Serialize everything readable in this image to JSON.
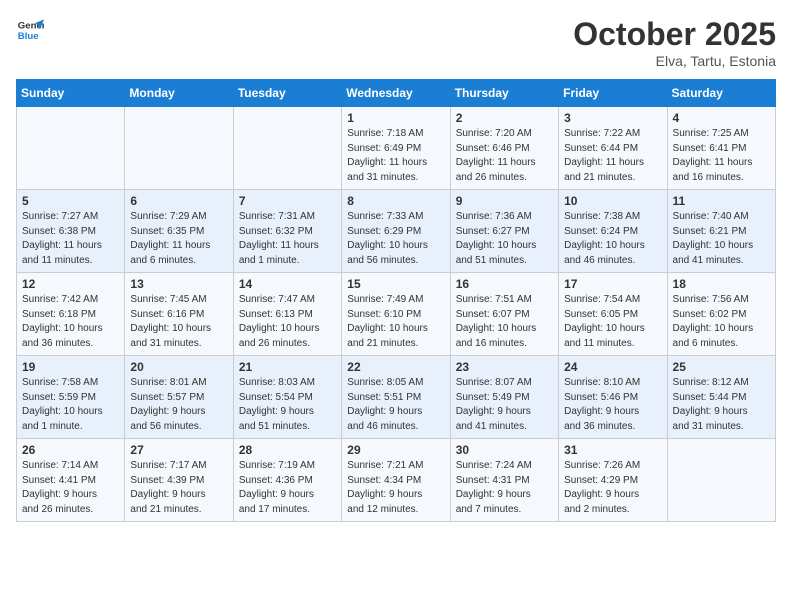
{
  "header": {
    "logo_line1": "General",
    "logo_line2": "Blue",
    "month": "October 2025",
    "location": "Elva, Tartu, Estonia"
  },
  "weekdays": [
    "Sunday",
    "Monday",
    "Tuesday",
    "Wednesday",
    "Thursday",
    "Friday",
    "Saturday"
  ],
  "weeks": [
    [
      {
        "day": "",
        "info": ""
      },
      {
        "day": "",
        "info": ""
      },
      {
        "day": "",
        "info": ""
      },
      {
        "day": "1",
        "info": "Sunrise: 7:18 AM\nSunset: 6:49 PM\nDaylight: 11 hours\nand 31 minutes."
      },
      {
        "day": "2",
        "info": "Sunrise: 7:20 AM\nSunset: 6:46 PM\nDaylight: 11 hours\nand 26 minutes."
      },
      {
        "day": "3",
        "info": "Sunrise: 7:22 AM\nSunset: 6:44 PM\nDaylight: 11 hours\nand 21 minutes."
      },
      {
        "day": "4",
        "info": "Sunrise: 7:25 AM\nSunset: 6:41 PM\nDaylight: 11 hours\nand 16 minutes."
      }
    ],
    [
      {
        "day": "5",
        "info": "Sunrise: 7:27 AM\nSunset: 6:38 PM\nDaylight: 11 hours\nand 11 minutes."
      },
      {
        "day": "6",
        "info": "Sunrise: 7:29 AM\nSunset: 6:35 PM\nDaylight: 11 hours\nand 6 minutes."
      },
      {
        "day": "7",
        "info": "Sunrise: 7:31 AM\nSunset: 6:32 PM\nDaylight: 11 hours\nand 1 minute."
      },
      {
        "day": "8",
        "info": "Sunrise: 7:33 AM\nSunset: 6:29 PM\nDaylight: 10 hours\nand 56 minutes."
      },
      {
        "day": "9",
        "info": "Sunrise: 7:36 AM\nSunset: 6:27 PM\nDaylight: 10 hours\nand 51 minutes."
      },
      {
        "day": "10",
        "info": "Sunrise: 7:38 AM\nSunset: 6:24 PM\nDaylight: 10 hours\nand 46 minutes."
      },
      {
        "day": "11",
        "info": "Sunrise: 7:40 AM\nSunset: 6:21 PM\nDaylight: 10 hours\nand 41 minutes."
      }
    ],
    [
      {
        "day": "12",
        "info": "Sunrise: 7:42 AM\nSunset: 6:18 PM\nDaylight: 10 hours\nand 36 minutes."
      },
      {
        "day": "13",
        "info": "Sunrise: 7:45 AM\nSunset: 6:16 PM\nDaylight: 10 hours\nand 31 minutes."
      },
      {
        "day": "14",
        "info": "Sunrise: 7:47 AM\nSunset: 6:13 PM\nDaylight: 10 hours\nand 26 minutes."
      },
      {
        "day": "15",
        "info": "Sunrise: 7:49 AM\nSunset: 6:10 PM\nDaylight: 10 hours\nand 21 minutes."
      },
      {
        "day": "16",
        "info": "Sunrise: 7:51 AM\nSunset: 6:07 PM\nDaylight: 10 hours\nand 16 minutes."
      },
      {
        "day": "17",
        "info": "Sunrise: 7:54 AM\nSunset: 6:05 PM\nDaylight: 10 hours\nand 11 minutes."
      },
      {
        "day": "18",
        "info": "Sunrise: 7:56 AM\nSunset: 6:02 PM\nDaylight: 10 hours\nand 6 minutes."
      }
    ],
    [
      {
        "day": "19",
        "info": "Sunrise: 7:58 AM\nSunset: 5:59 PM\nDaylight: 10 hours\nand 1 minute."
      },
      {
        "day": "20",
        "info": "Sunrise: 8:01 AM\nSunset: 5:57 PM\nDaylight: 9 hours\nand 56 minutes."
      },
      {
        "day": "21",
        "info": "Sunrise: 8:03 AM\nSunset: 5:54 PM\nDaylight: 9 hours\nand 51 minutes."
      },
      {
        "day": "22",
        "info": "Sunrise: 8:05 AM\nSunset: 5:51 PM\nDaylight: 9 hours\nand 46 minutes."
      },
      {
        "day": "23",
        "info": "Sunrise: 8:07 AM\nSunset: 5:49 PM\nDaylight: 9 hours\nand 41 minutes."
      },
      {
        "day": "24",
        "info": "Sunrise: 8:10 AM\nSunset: 5:46 PM\nDaylight: 9 hours\nand 36 minutes."
      },
      {
        "day": "25",
        "info": "Sunrise: 8:12 AM\nSunset: 5:44 PM\nDaylight: 9 hours\nand 31 minutes."
      }
    ],
    [
      {
        "day": "26",
        "info": "Sunrise: 7:14 AM\nSunset: 4:41 PM\nDaylight: 9 hours\nand 26 minutes."
      },
      {
        "day": "27",
        "info": "Sunrise: 7:17 AM\nSunset: 4:39 PM\nDaylight: 9 hours\nand 21 minutes."
      },
      {
        "day": "28",
        "info": "Sunrise: 7:19 AM\nSunset: 4:36 PM\nDaylight: 9 hours\nand 17 minutes."
      },
      {
        "day": "29",
        "info": "Sunrise: 7:21 AM\nSunset: 4:34 PM\nDaylight: 9 hours\nand 12 minutes."
      },
      {
        "day": "30",
        "info": "Sunrise: 7:24 AM\nSunset: 4:31 PM\nDaylight: 9 hours\nand 7 minutes."
      },
      {
        "day": "31",
        "info": "Sunrise: 7:26 AM\nSunset: 4:29 PM\nDaylight: 9 hours\nand 2 minutes."
      },
      {
        "day": "",
        "info": ""
      }
    ]
  ]
}
